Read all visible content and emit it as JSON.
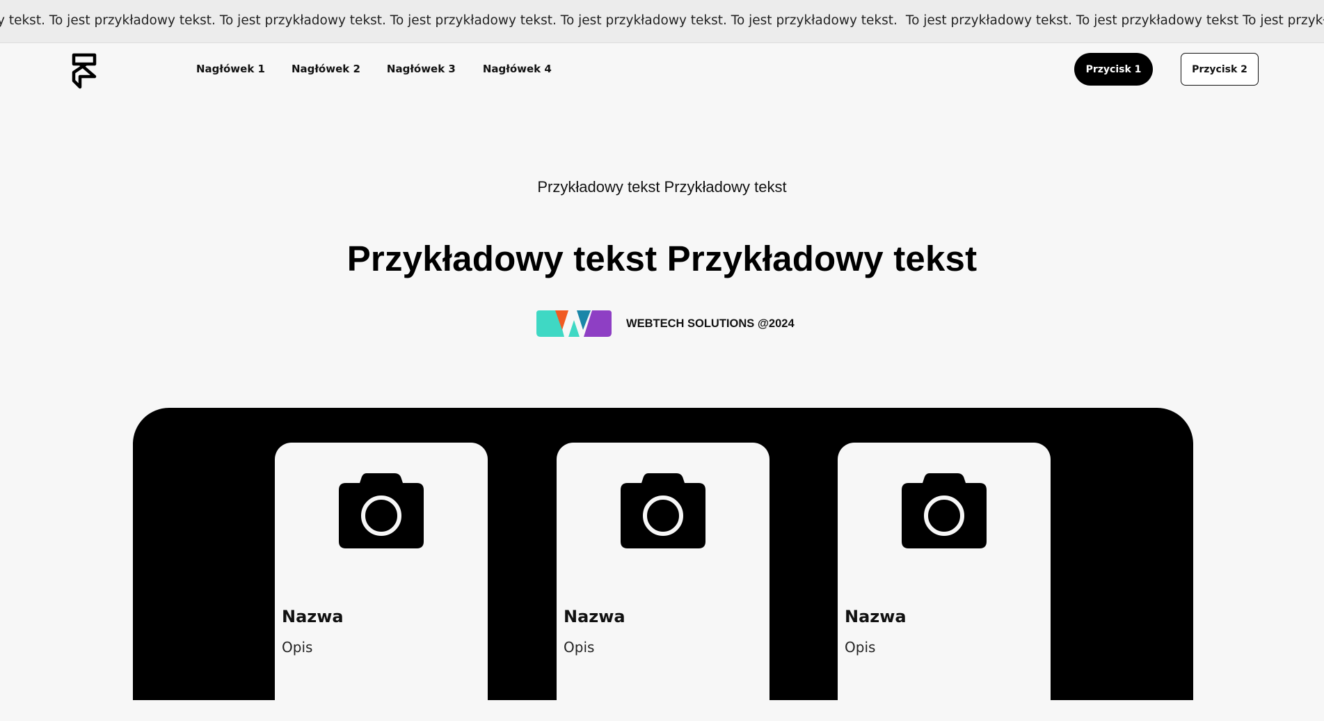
{
  "marquee": {
    "text_a": "y tekst. To jest przykładowy tekst. To jest przykładowy tekst. To jest przykładowy tekst. To jest przykładowy tekst. To jest przykładowy tekst.",
    "text_b": "To jest przykładowy tekst. To jest przykładowy tekst To jest przykładowy tekst. To jest"
  },
  "header": {
    "logo_icon": "framer-logo-icon",
    "nav": [
      "Nagłówek 1",
      "Nagłówek 2",
      "Nagłówek 3",
      "Nagłówek 4"
    ],
    "button_primary": "Przycisk 1",
    "button_secondary": "Przycisk 2"
  },
  "hero": {
    "subtitle": "Przykładowy tekst Przykładowy tekst",
    "title": "Przykładowy tekst Przykładowy tekst",
    "brand_text": "WEBTECH SOLUTIONS @2024",
    "brand_colors": [
      "#3fd8c4",
      "#f05a22",
      "#1a86a8",
      "#8e3fc4"
    ]
  },
  "cards": [
    {
      "icon": "camera-icon",
      "title": "Nazwa",
      "description": "Opis"
    },
    {
      "icon": "camera-icon",
      "title": "Nazwa",
      "description": "Opis"
    },
    {
      "icon": "camera-icon",
      "title": "Nazwa",
      "description": "Opis"
    }
  ],
  "colors": {
    "background": "#f7f7f7",
    "marquee_bg": "#ececec",
    "dark_section": "#000000"
  }
}
